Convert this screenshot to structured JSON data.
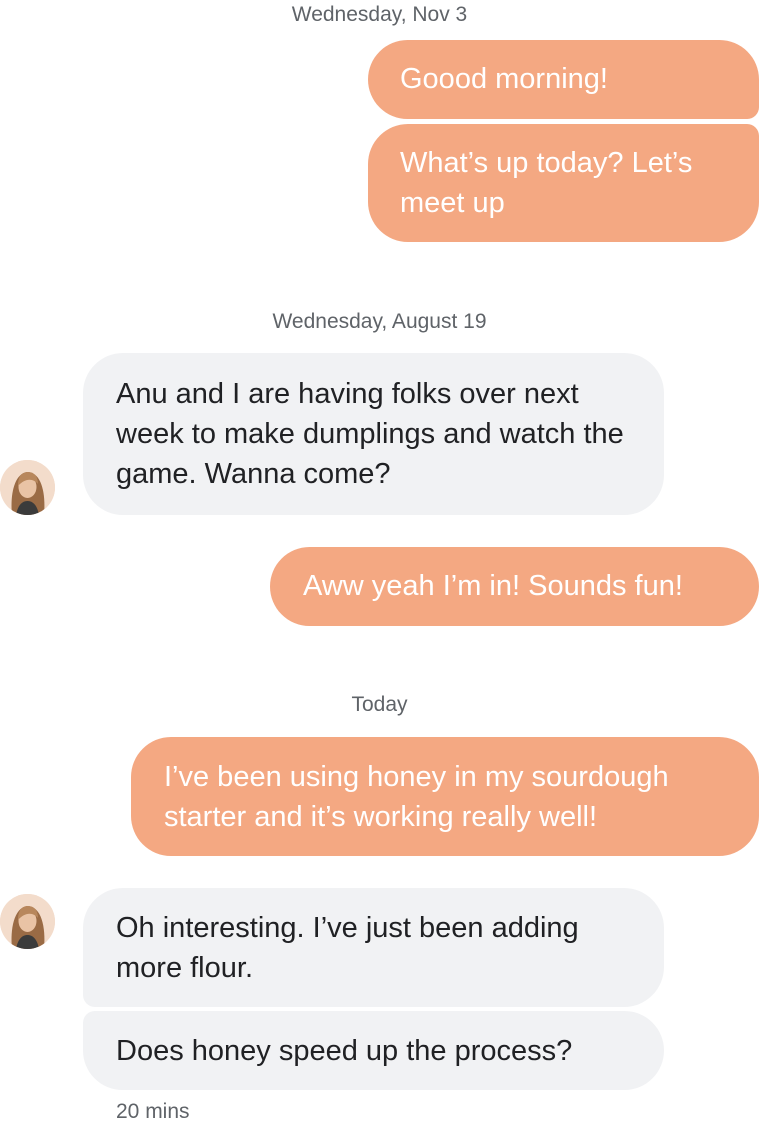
{
  "conversation": {
    "date_1": "Wednesday, Nov 3",
    "date_2": "Wednesday, August 19",
    "date_3": "Today",
    "messages": [
      {
        "sender": "me",
        "text": "Goood morning!"
      },
      {
        "sender": "me",
        "text": "What’s up today? Let’s meet up"
      },
      {
        "sender": "contact",
        "text": "Anu and I are having folks over next week to make dumplings and watch the game. Wanna come?"
      },
      {
        "sender": "me",
        "text": "Aww yeah I’m in! Sounds fun!"
      },
      {
        "sender": "me",
        "text": "I’ve been using honey in my sourdough starter and it’s working really well!"
      },
      {
        "sender": "contact",
        "text": "Oh interesting. I’ve just been adding more flour."
      },
      {
        "sender": "contact",
        "text": "Does honey speed up the process?"
      }
    ],
    "last_timestamp": "20 mins"
  },
  "colors": {
    "outgoing_bubble": "#f4a882",
    "incoming_bubble": "#f1f2f4",
    "date_text": "#5f6368"
  },
  "icons": {
    "avatar": "contact-avatar-photo"
  }
}
